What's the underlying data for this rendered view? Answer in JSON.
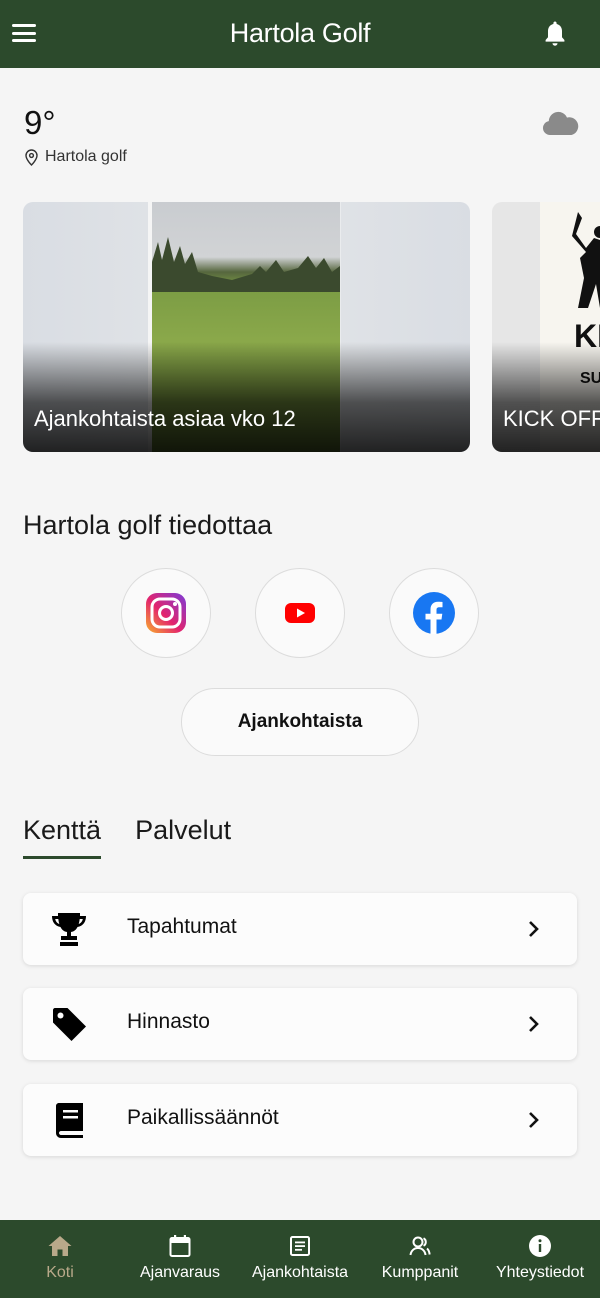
{
  "header": {
    "title": "Hartola Golf",
    "menu_icon": "menu-icon",
    "bell_icon": "bell-icon"
  },
  "weather": {
    "temperature": "9°",
    "location": "Hartola golf",
    "condition_icon": "cloud-icon"
  },
  "news_cards": [
    {
      "caption": "Ajankohtaista asiaa vko 12"
    },
    {
      "caption": "KICK OFF",
      "poster_big": "KI",
      "poster_small": "SU"
    }
  ],
  "info": {
    "title": "Hartola golf tiedottaa",
    "social": [
      "instagram-icon",
      "youtube-icon",
      "facebook-icon"
    ],
    "news_button": "Ajankohtaista"
  },
  "tabs": [
    {
      "label": "Kenttä",
      "active": true
    },
    {
      "label": "Palvelut",
      "active": false
    }
  ],
  "list": [
    {
      "label": "Tapahtumat",
      "icon": "trophy-icon"
    },
    {
      "label": "Hinnasto",
      "icon": "tag-icon"
    },
    {
      "label": "Paikallissäännöt",
      "icon": "book-icon"
    }
  ],
  "bottom_nav": [
    {
      "label": "Koti",
      "icon": "home-icon",
      "active": true
    },
    {
      "label": "Ajanvaraus",
      "icon": "calendar-icon"
    },
    {
      "label": "Ajankohtaista",
      "icon": "news-icon"
    },
    {
      "label": "Kumppanit",
      "icon": "partners-icon"
    },
    {
      "label": "Yhteystiedot",
      "icon": "info-icon"
    }
  ],
  "colors": {
    "brand_green": "#2c4a2c",
    "active_nav": "#b9a98a",
    "background": "#f5f5f5"
  }
}
